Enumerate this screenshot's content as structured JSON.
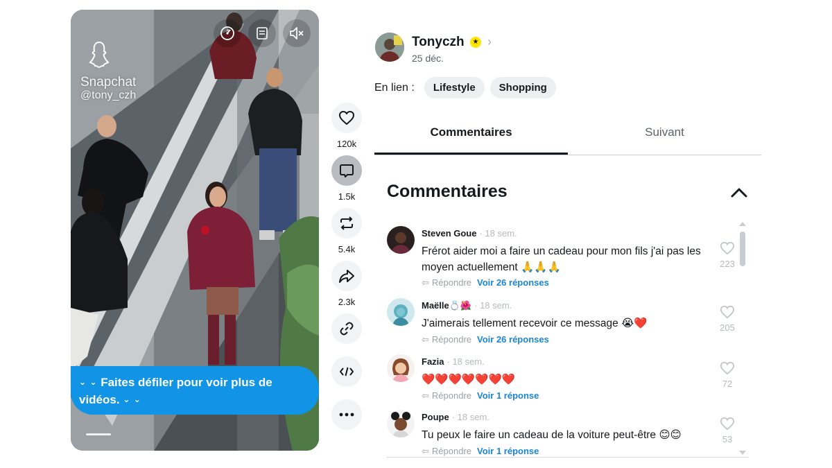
{
  "video": {
    "watermark_brand": "Snapchat",
    "watermark_handle": "@tony_czh",
    "scroll_hint_line1": "Faites défiler pour voir plus de",
    "scroll_hint_line2": "vidéos.",
    "scroll_hint_chevrons": "⌄ ⌄",
    "controls": [
      "speedometer-icon",
      "caption-icon",
      "mute-icon"
    ]
  },
  "actions": [
    {
      "name": "like",
      "icon": "heart-icon",
      "count": "120k"
    },
    {
      "name": "comment",
      "icon": "comment-icon",
      "count": "1.5k"
    },
    {
      "name": "remix",
      "icon": "repost-icon",
      "count": "5.4k"
    },
    {
      "name": "share",
      "icon": "share-icon",
      "count": "2.3k"
    },
    {
      "name": "copy-link",
      "icon": "link-icon",
      "count": ""
    },
    {
      "name": "embed",
      "icon": "embed-icon",
      "count": ""
    },
    {
      "name": "more",
      "icon": "more-icon",
      "count": ""
    }
  ],
  "profile": {
    "username": "Tonyczh",
    "verified_glyph": "★",
    "chevron": "›",
    "date": "25 déc."
  },
  "linked": {
    "label": "En lien :",
    "chips": [
      "Lifestyle",
      "Shopping"
    ]
  },
  "tabs": {
    "comments": "Commentaires",
    "following": "Suivant"
  },
  "comments": {
    "heading": "Commentaires",
    "reply_label": "Répondre",
    "items": [
      {
        "author": "Steven Goue",
        "ago": "· 18 sem.",
        "text": "Frérot aider moi a faire un cadeau pour mon fils j'ai pas les moyen actuellement 🙏🙏🙏",
        "likes": "223",
        "replies": "Voir 26 réponses"
      },
      {
        "author": "Maëlle💍🌺",
        "ago": "· 18 sem.",
        "text": "J'aimerais tellement recevoir ce message 😭❤️",
        "likes": "205",
        "replies": "Voir 26 réponses"
      },
      {
        "author": "Fazia",
        "ago": "· 18 sem.",
        "text": "❤️❤️❤️❤️❤️❤️❤️",
        "likes": "72",
        "replies": "Voir 1 réponse"
      },
      {
        "author": "Poupe",
        "ago": "· 18 sem.",
        "text": "Tu peux le faire un cadeau de la voiture peut-être 😊😊",
        "likes": "53",
        "replies": "Voir 1 réponse"
      }
    ]
  },
  "colors": {
    "accent_blue": "#1193e6",
    "link_blue": "#1a86d8",
    "snap_yellow": "#ffe500",
    "text_dark": "#16191c",
    "muted": "#9da2a6"
  }
}
